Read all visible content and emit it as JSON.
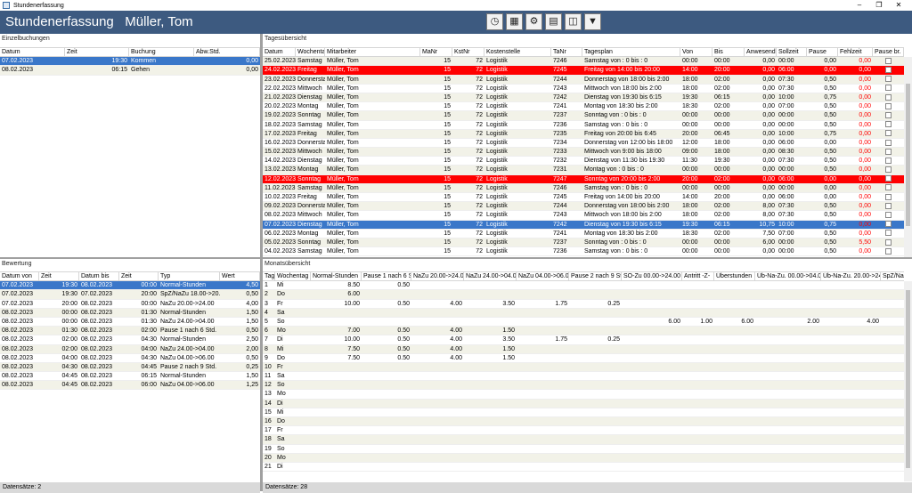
{
  "window": {
    "title": "Stundenerfassung"
  },
  "header": {
    "title": "Stundenerfassung   Müller, Tom"
  },
  "toolbar": {
    "icons": [
      "clock-icon",
      "calendar-icon",
      "settings-icon",
      "calculator-icon",
      "report-icon",
      "filter-icon"
    ]
  },
  "einzelbuchungen": {
    "title": "Einzelbuchungen",
    "columns": [
      "Datum",
      "Zeit",
      "Buchung",
      "Abw.Std."
    ],
    "rows": [
      [
        "07.02.2023",
        "19:30",
        "Kommen",
        "0,00"
      ],
      [
        "08.02.2023",
        "06:15",
        "Gehen",
        "0,00"
      ]
    ]
  },
  "tagesuebersicht": {
    "title": "Tagesübersicht",
    "columns": [
      "Datum",
      "Wochentag",
      "Mitarbeiter",
      "MaNr",
      "KstNr",
      "Kostenstelle",
      "TaNr",
      "Tagesplan",
      "Von",
      "Bis",
      "Anwesend",
      "Sollzeit",
      "Pause",
      "Fehlzeit",
      "Pause br."
    ],
    "rows": [
      [
        "25.02.2023",
        "Samstag",
        "Müller, Tom",
        "15",
        "72",
        "Logistik",
        "7246",
        "Samstag von  : 0 bis  : 0",
        "00:00",
        "00:00",
        "0,00",
        "00:00",
        "0,00",
        "0,00"
      ],
      [
        "24.02.2023",
        "Freitag",
        "Müller, Tom",
        "15",
        "72",
        "Logistik",
        "7245",
        "Freitag von 14:00 bis 20:00",
        "14:00",
        "20:00",
        "0,00",
        "06:00",
        "0,00",
        "0,00"
      ],
      [
        "23.02.2023",
        "Donnerstag",
        "Müller, Tom",
        "15",
        "72",
        "Logistik",
        "7244",
        "Donnerstag von 18:00 bis  2:00",
        "18:00",
        "02:00",
        "0,00",
        "07:30",
        "0,50",
        "0,00"
      ],
      [
        "22.02.2023",
        "Mittwoch",
        "Müller, Tom",
        "15",
        "72",
        "Logistik",
        "7243",
        "Mittwoch von 18:00 bis  2:00",
        "18:00",
        "02:00",
        "0,00",
        "07:30",
        "0,50",
        "0,00"
      ],
      [
        "21.02.2023",
        "Dienstag",
        "Müller, Tom",
        "15",
        "72",
        "Logistik",
        "7242",
        "Dienstag von 19:30 bis  6:15",
        "19:30",
        "06:15",
        "0,00",
        "10:00",
        "0,75",
        "0,00"
      ],
      [
        "20.02.2023",
        "Montag",
        "Müller, Tom",
        "15",
        "72",
        "Logistik",
        "7241",
        "Montag von 18:30 bis  2:00",
        "18:30",
        "02:00",
        "0,00",
        "07:00",
        "0,50",
        "0,00"
      ],
      [
        "19.02.2023",
        "Sonntag",
        "Müller, Tom",
        "15",
        "72",
        "Logistik",
        "7237",
        "Sonntag von  : 0 bis  : 0",
        "00:00",
        "00:00",
        "0,00",
        "00:00",
        "0,50",
        "0,00"
      ],
      [
        "18.02.2023",
        "Samstag",
        "Müller, Tom",
        "15",
        "72",
        "Logistik",
        "7236",
        "Samstag von  : 0 bis  : 0",
        "00:00",
        "00:00",
        "0,00",
        "00:00",
        "0,50",
        "0,00"
      ],
      [
        "17.02.2023",
        "Freitag",
        "Müller, Tom",
        "15",
        "72",
        "Logistik",
        "7235",
        "Freitag von 20:00 bis  6:45",
        "20:00",
        "06:45",
        "0,00",
        "10:00",
        "0,75",
        "0,00"
      ],
      [
        "16.02.2023",
        "Donnerstag",
        "Müller, Tom",
        "15",
        "72",
        "Logistik",
        "7234",
        "Donnerstag von 12:00 bis 18:00",
        "12:00",
        "18:00",
        "0,00",
        "06:00",
        "0,00",
        "0,00"
      ],
      [
        "15.02.2023",
        "Mittwoch",
        "Müller, Tom",
        "15",
        "72",
        "Logistik",
        "7233",
        "Mittwoch von  9:00 bis 18:00",
        "09:00",
        "18:00",
        "0,00",
        "08:30",
        "0,50",
        "0,00"
      ],
      [
        "14.02.2023",
        "Dienstag",
        "Müller, Tom",
        "15",
        "72",
        "Logistik",
        "7232",
        "Dienstag von 11:30 bis 19:30",
        "11:30",
        "19:30",
        "0,00",
        "07:30",
        "0,50",
        "0,00"
      ],
      [
        "13.02.2023",
        "Montag",
        "Müller, Tom",
        "15",
        "72",
        "Logistik",
        "7231",
        "Montag von  : 0 bis  : 0",
        "00:00",
        "00:00",
        "0,00",
        "00:00",
        "0,50",
        "0,00"
      ],
      [
        "12.02.2023",
        "Sonntag",
        "Müller, Tom",
        "15",
        "72",
        "Logistik",
        "7247",
        "Sonntag von 20:00 bis  2:00",
        "20:00",
        "02:00",
        "0,00",
        "06:00",
        "0,00",
        "0,00"
      ],
      [
        "11.02.2023",
        "Samstag",
        "Müller, Tom",
        "15",
        "72",
        "Logistik",
        "7246",
        "Samstag von  : 0 bis  : 0",
        "00:00",
        "00:00",
        "0,00",
        "00:00",
        "0,00",
        "0,00"
      ],
      [
        "10.02.2023",
        "Freitag",
        "Müller, Tom",
        "15",
        "72",
        "Logistik",
        "7245",
        "Freitag von 14:00 bis 20:00",
        "14:00",
        "20:00",
        "0,00",
        "06:00",
        "0,00",
        "0,00"
      ],
      [
        "09.02.2023",
        "Donnerstag",
        "Müller, Tom",
        "15",
        "72",
        "Logistik",
        "7244",
        "Donnerstag von 18:00 bis  2:00",
        "18:00",
        "02:00",
        "8,00",
        "07:30",
        "0,50",
        "0,00"
      ],
      [
        "08.02.2023",
        "Mittwoch",
        "Müller, Tom",
        "15",
        "72",
        "Logistik",
        "7243",
        "Mittwoch von 18:00 bis  2:00",
        "18:00",
        "02:00",
        "8,00",
        "07:30",
        "0,50",
        "0,00"
      ],
      [
        "07.02.2023",
        "Dienstag",
        "Müller, Tom",
        "15",
        "72",
        "Logistik",
        "7242",
        "Dienstag von 19:30 bis  6:15",
        "19:30",
        "06:15",
        "10,75",
        "10:00",
        "0,75",
        "0,00"
      ],
      [
        "06.02.2023",
        "Montag",
        "Müller, Tom",
        "15",
        "72",
        "Logistik",
        "7241",
        "Montag von 18:30 bis  2:00",
        "18:30",
        "02:00",
        "7,50",
        "07:00",
        "0,50",
        "0,00"
      ],
      [
        "05.02.2023",
        "Sonntag",
        "Müller, Tom",
        "15",
        "72",
        "Logistik",
        "7237",
        "Sonntag von  : 0 bis  : 0",
        "00:00",
        "00:00",
        "6,00",
        "00:00",
        "0,50",
        "5,50"
      ],
      [
        "04.02.2023",
        "Samstag",
        "Müller, Tom",
        "15",
        "72",
        "Logistik",
        "7236",
        "Samstag von  : 0 bis  : 0",
        "00:00",
        "00:00",
        "0,00",
        "00:00",
        "0,50",
        "0,00"
      ]
    ]
  },
  "bewertung": {
    "title": "Bewertung",
    "columns": [
      "Datum von",
      "Zeit",
      "Datum bis",
      "Zeit",
      "Typ",
      "Wert"
    ],
    "rows": [
      [
        "07.02.2023",
        "19:30",
        "08.02.2023",
        "00:00",
        "Normal-Stunden",
        "4,50"
      ],
      [
        "07.02.2023",
        "19:30",
        "07.02.2023",
        "20:00",
        "SpZ/NaZu 18.00->20.0",
        "0,50"
      ],
      [
        "07.02.2023",
        "20:00",
        "08.02.2023",
        "00:00",
        "NaZu  20.00->24.00",
        "4,00"
      ],
      [
        "08.02.2023",
        "00:00",
        "08.02.2023",
        "01:30",
        "Normal-Stunden",
        "1,50"
      ],
      [
        "08.02.2023",
        "00:00",
        "08.02.2023",
        "01:30",
        "NaZu 24.00->04.00",
        "1,50"
      ],
      [
        "08.02.2023",
        "01:30",
        "08.02.2023",
        "02:00",
        "Pause 1 nach 6 Std.",
        "0,50"
      ],
      [
        "08.02.2023",
        "02:00",
        "08.02.2023",
        "04:30",
        "Normal-Stunden",
        "2,50"
      ],
      [
        "08.02.2023",
        "02:00",
        "08.02.2023",
        "04:00",
        "NaZu 24.00->04.00",
        "2,00"
      ],
      [
        "08.02.2023",
        "04:00",
        "08.02.2023",
        "04:30",
        "NaZu 04.00->06.00",
        "0,50"
      ],
      [
        "08.02.2023",
        "04:30",
        "08.02.2023",
        "04:45",
        "Pause 2 nach 9 Std.",
        "0,25"
      ],
      [
        "08.02.2023",
        "04:45",
        "08.02.2023",
        "06:15",
        "Normal-Stunden",
        "1,50"
      ],
      [
        "08.02.2023",
        "04:45",
        "08.02.2023",
        "06:00",
        "NaZu 04.00->06.00",
        "1,25"
      ]
    ]
  },
  "monatsuebersicht": {
    "title": "Monatsübersicht",
    "columns": [
      "Tag",
      "Wochentag",
      "Normal-Stunden",
      "Pause 1 nach 6 Std.",
      "NaZu  20.00->24.00",
      "NaZu 24.00->04.00",
      "NaZu 04.00->06.00",
      "Pause 2 nach 9 Std.",
      "SO-Zu  00.00->24.00",
      "Antritt -Z-",
      "Überstunden",
      "Üb-Na-Zu. 00.00->04.00",
      "Üb-Na-Zu. 20.00->24.00",
      "SpZ/NaZu"
    ],
    "rows": [
      [
        "1",
        "Mi",
        "8.50",
        "0.50",
        "",
        "",
        "",
        "",
        "",
        "",
        "",
        "",
        "",
        ""
      ],
      [
        "2",
        "Do",
        "6.00",
        "",
        "",
        "",
        "",
        "",
        "",
        "",
        "",
        "",
        "",
        ""
      ],
      [
        "3",
        "Fr",
        "10.00",
        "0.50",
        "4.00",
        "3.50",
        "1.75",
        "0.25",
        "",
        "",
        "",
        "",
        "",
        ""
      ],
      [
        "4",
        "Sa",
        "",
        "",
        "",
        "",
        "",
        "",
        "",
        "",
        "",
        "",
        "",
        ""
      ],
      [
        "5",
        "So",
        "",
        "",
        "",
        "",
        "",
        "",
        "6.00",
        "1.00",
        "6.00",
        "2.00",
        "4.00",
        ""
      ],
      [
        "6",
        "Mo",
        "7.00",
        "0.50",
        "4.00",
        "1.50",
        "",
        "",
        "",
        "",
        "",
        "",
        "",
        ""
      ],
      [
        "7",
        "Di",
        "10.00",
        "0.50",
        "4.00",
        "3.50",
        "1.75",
        "0.25",
        "",
        "",
        "",
        "",
        "",
        ""
      ],
      [
        "8",
        "Mi",
        "7.50",
        "0.50",
        "4.00",
        "1.50",
        "",
        "",
        "",
        "",
        "",
        "",
        "",
        ""
      ],
      [
        "9",
        "Do",
        "7.50",
        "0.50",
        "4.00",
        "1.50",
        "",
        "",
        "",
        "",
        "",
        "",
        "",
        ""
      ],
      [
        "10",
        "Fr",
        "",
        "",
        "",
        "",
        "",
        "",
        "",
        "",
        "",
        "",
        "",
        ""
      ],
      [
        "11",
        "Sa",
        "",
        "",
        "",
        "",
        "",
        "",
        "",
        "",
        "",
        "",
        "",
        ""
      ],
      [
        "12",
        "So",
        "",
        "",
        "",
        "",
        "",
        "",
        "",
        "",
        "",
        "",
        "",
        ""
      ],
      [
        "13",
        "Mo",
        "",
        "",
        "",
        "",
        "",
        "",
        "",
        "",
        "",
        "",
        "",
        ""
      ],
      [
        "14",
        "Di",
        "",
        "",
        "",
        "",
        "",
        "",
        "",
        "",
        "",
        "",
        "",
        ""
      ],
      [
        "15",
        "Mi",
        "",
        "",
        "",
        "",
        "",
        "",
        "",
        "",
        "",
        "",
        "",
        ""
      ],
      [
        "16",
        "Do",
        "",
        "",
        "",
        "",
        "",
        "",
        "",
        "",
        "",
        "",
        "",
        ""
      ],
      [
        "17",
        "Fr",
        "",
        "",
        "",
        "",
        "",
        "",
        "",
        "",
        "",
        "",
        "",
        ""
      ],
      [
        "18",
        "Sa",
        "",
        "",
        "",
        "",
        "",
        "",
        "",
        "",
        "",
        "",
        "",
        ""
      ],
      [
        "19",
        "So",
        "",
        "",
        "",
        "",
        "",
        "",
        "",
        "",
        "",
        "",
        "",
        ""
      ],
      [
        "20",
        "Mo",
        "",
        "",
        "",
        "",
        "",
        "",
        "",
        "",
        "",
        "",
        "",
        ""
      ],
      [
        "21",
        "Di",
        "",
        "",
        "",
        "",
        "",
        "",
        "",
        "",
        "",
        "",
        "",
        ""
      ]
    ]
  },
  "footer": {
    "left": "Datensätze:  2",
    "right": "Datensätze:  28"
  }
}
